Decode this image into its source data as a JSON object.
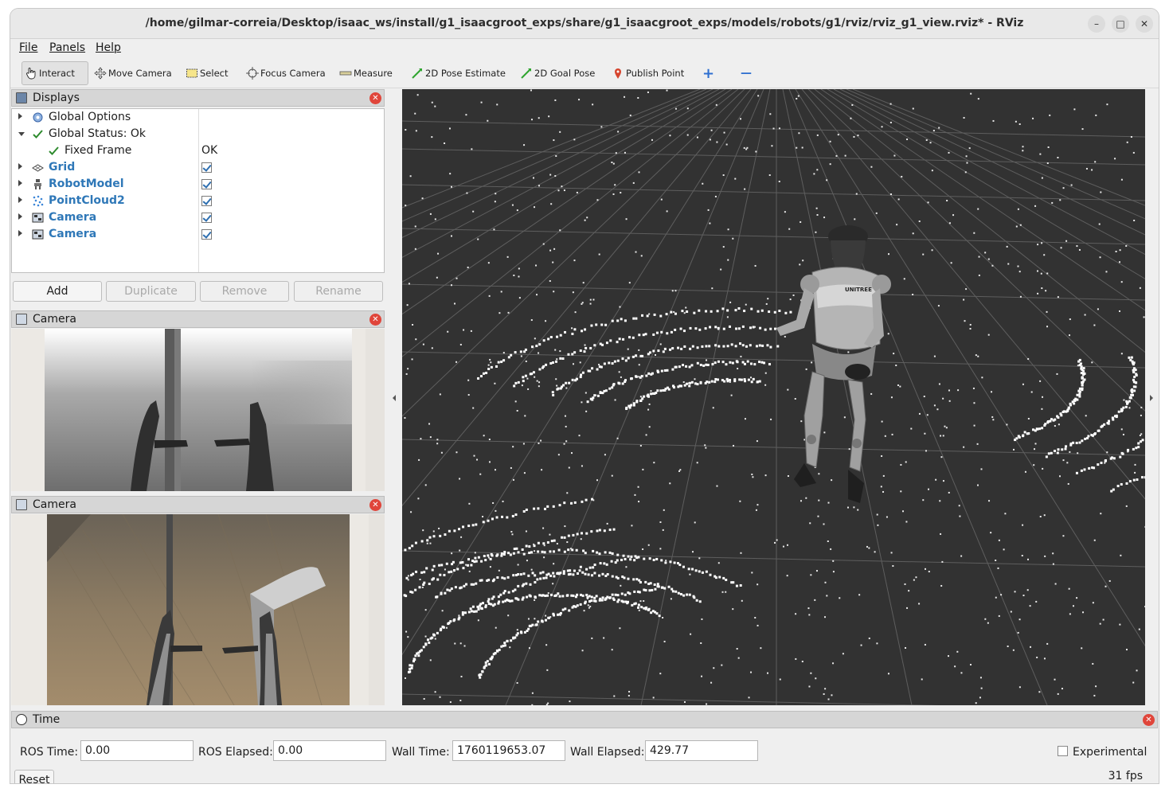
{
  "window": {
    "title": "/home/gilmar-correia/Desktop/isaac_ws/install/g1_isaacgroot_exps/share/g1_isaacgroot_exps/models/robots/g1/rviz/rviz_g1_view.rviz* - RViz",
    "minimize": "–",
    "maximize": "□",
    "close": "✕"
  },
  "menu": {
    "file": "File",
    "panels": "Panels",
    "help": "Help"
  },
  "toolbar": {
    "interact": "Interact",
    "move_camera": "Move Camera",
    "select": "Select",
    "focus_camera": "Focus Camera",
    "measure": "Measure",
    "pose_estimate": "2D Pose Estimate",
    "goal_pose": "2D Goal Pose",
    "publish_point": "Publish Point",
    "plus": "+",
    "minus": "—"
  },
  "displays": {
    "title": "Displays",
    "rows": [
      {
        "label": "Global Options",
        "value": ""
      },
      {
        "label": "Global Status: Ok",
        "value": ""
      },
      {
        "label": "Fixed Frame",
        "value": "OK"
      },
      {
        "label": "Grid",
        "value": ""
      },
      {
        "label": "RobotModel",
        "value": ""
      },
      {
        "label": "PointCloud2",
        "value": ""
      },
      {
        "label": "Camera",
        "value": ""
      },
      {
        "label": "Camera",
        "value": ""
      }
    ],
    "buttons": {
      "add": "Add",
      "duplicate": "Duplicate",
      "remove": "Remove",
      "rename": "Rename"
    }
  },
  "camera_panels": [
    {
      "title": "Camera"
    },
    {
      "title": "Camera"
    }
  ],
  "time": {
    "title": "Time",
    "ros_time_label": "ROS Time:",
    "ros_time": "0.00",
    "ros_elapsed_label": "ROS Elapsed:",
    "ros_elapsed": "0.00",
    "wall_time_label": "Wall Time:",
    "wall_time": "1760119653.07",
    "wall_elapsed_label": "Wall Elapsed:",
    "wall_elapsed": "429.77",
    "experimental": "Experimental",
    "reset": "Reset",
    "fps": "31 fps"
  },
  "robot_chest_logo": "UNITREE"
}
